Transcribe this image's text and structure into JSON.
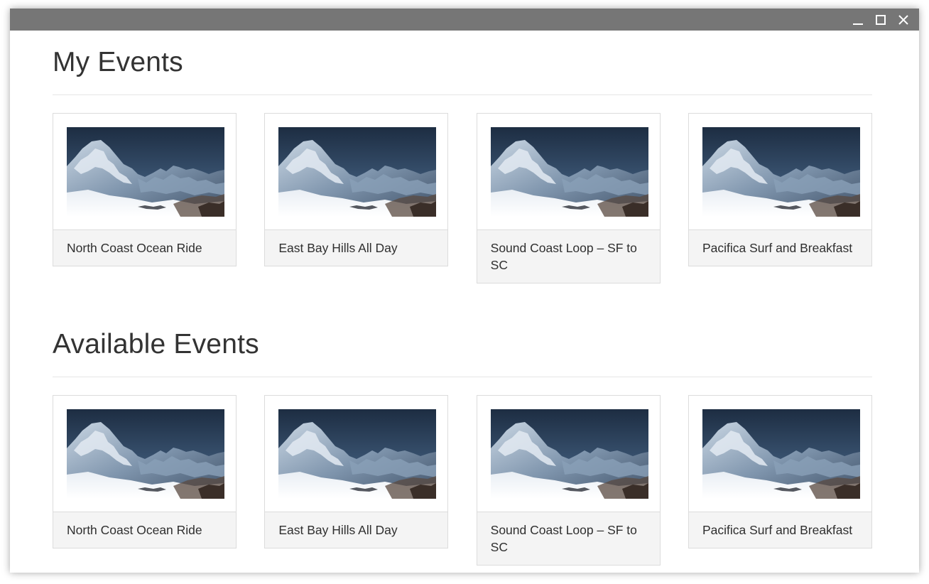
{
  "window": {
    "controls": [
      "minimize-icon",
      "maximize-icon",
      "close-icon"
    ],
    "titlebar_color": "#767676"
  },
  "sections": {
    "my_events": {
      "title": "My Events",
      "events": [
        {
          "name": "North Coast Ocean Ride",
          "image": "snowy-mountain-image"
        },
        {
          "name": "East Bay Hills All Day",
          "image": "snowy-mountain-image"
        },
        {
          "name": "Sound Coast Loop – SF to SC",
          "image": "snowy-mountain-image"
        },
        {
          "name": "Pacifica Surf and Breakfast",
          "image": "snowy-mountain-image"
        }
      ]
    },
    "available_events": {
      "title": "Available Events",
      "events": [
        {
          "name": "North Coast Ocean Ride",
          "image": "snowy-mountain-image"
        },
        {
          "name": "East Bay Hills All Day",
          "image": "snowy-mountain-image"
        },
        {
          "name": "Sound Coast Loop – SF to SC",
          "image": "snowy-mountain-image"
        },
        {
          "name": "Pacifica Surf and Breakfast",
          "image": "snowy-mountain-image"
        }
      ]
    }
  }
}
